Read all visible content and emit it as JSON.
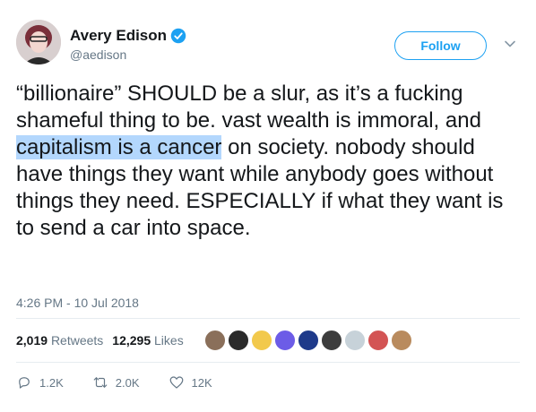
{
  "user": {
    "name": "Avery Edison",
    "handle": "@aedison"
  },
  "follow_button": {
    "label": "Follow"
  },
  "tweet": {
    "text_before": "“billionaire” SHOULD be a slur, as it’s a fucking shameful thing to be. vast wealth is immoral, and ",
    "text_highlight": "capitalism is a cancer",
    "text_after": " on society. nobody should have things they want while anybody goes without things they need. ESPECIALLY if what they want is to send a car into space.",
    "timestamp": "4:26 PM - 10 Jul 2018"
  },
  "stats": {
    "retweets_count": "2,019",
    "retweets_label": "Retweets",
    "likes_count": "12,295",
    "likes_label": "Likes"
  },
  "liker_avatars": [
    "#8a6f5a",
    "#2b2b2b",
    "#f2c94c",
    "#6c5ce7",
    "#1e3a8a",
    "#3d3d3d",
    "#c7d2d9",
    "#d35454",
    "#b98b5e"
  ],
  "actions": {
    "reply_count": "1.2K",
    "retweet_count": "2.0K",
    "like_count": "12K"
  },
  "colors": {
    "accent": "#1da1f2",
    "highlight": "#b3d7fd",
    "muted": "#657786"
  }
}
